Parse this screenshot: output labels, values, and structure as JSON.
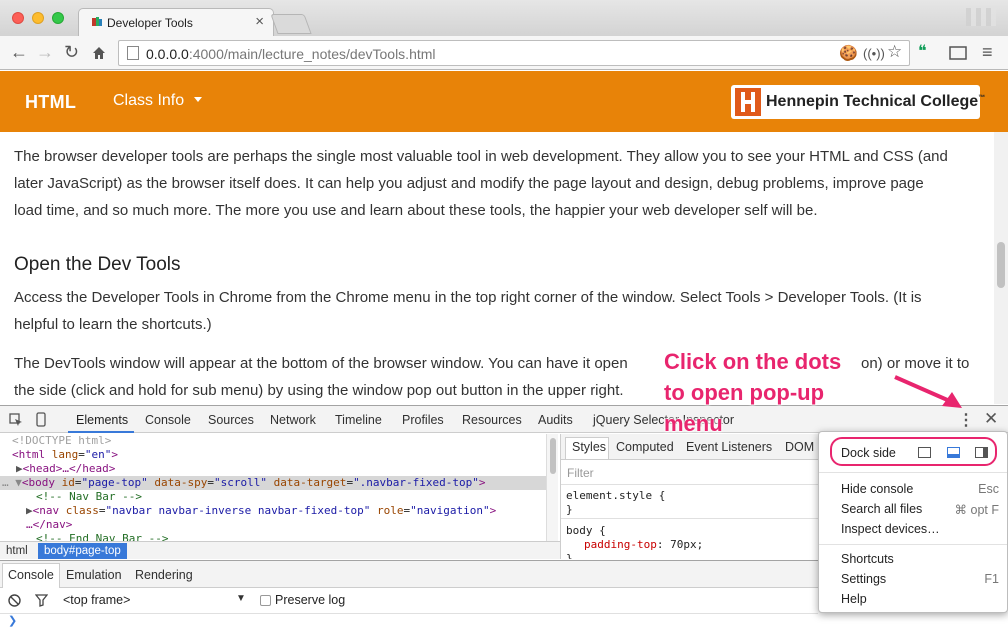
{
  "browser": {
    "tab_title": "Developer Tools",
    "tab_close": "×",
    "url_host": "0.0.0.0",
    "url_rest": ":4000/main/lecture_notes/devTools.html"
  },
  "site": {
    "brand": "HTML",
    "nav_item": "Class Info",
    "college_name": "Hennepin Technical College",
    "college_mark": "™"
  },
  "content": {
    "intro_lines": [
      "The browser developer tools are perhaps the single most valuable tool in web development. They allow you to see your HTML and CSS (and",
      "later JavaScript) as the browser itself does. It can help you adjust and modify the page layout and design, debug problems, improve page",
      "load time, and so much more. The more you use and learn about these tools, the happier your web developer self will be."
    ],
    "heading": "Open the Dev Tools",
    "open_lines": [
      "Access the Developer Tools in Chrome from the Chrome menu in the top right corner of the window. Select Tools > Developer Tools. (It is",
      "helpful to learn the shortcuts.)"
    ],
    "devtools_lines": [
      "The DevTools window will appear at the bottom of the browser window. You can have it open",
      "on) or move it to",
      "the side (click and hold for sub menu) by using the window pop out button in the upper right."
    ]
  },
  "devtools": {
    "tabs": [
      "Elements",
      "Console",
      "Sources",
      "Network",
      "Timeline",
      "Profiles",
      "Resources",
      "Audits",
      "jQuery Selector Inspector"
    ],
    "active_tab": "Elements",
    "code": {
      "doctype": "<!DOCTYPE html>",
      "html_open": "<html",
      "html_lang_attr": "lang",
      "html_lang_val": "\"en\"",
      "head": "<head>…</head>",
      "body_open": "<body",
      "body_id_attr": "id",
      "body_id_val": "\"page-top\"",
      "body_spy_attr": "data-spy",
      "body_spy_val": "\"scroll\"",
      "body_target_attr": "data-target",
      "body_target_val": "\".navbar-fixed-top\"",
      "comment_navbar": "<!-- Nav Bar -->",
      "nav_open": "<nav",
      "nav_class_attr": "class",
      "nav_class_val": "\"navbar navbar-inverse navbar-fixed-top\"",
      "nav_role_attr": "role",
      "nav_role_val": "\"navigation\"",
      "nav_close": "…</nav>",
      "comment_end": "<!-- End Nav Bar -->"
    },
    "breadcrumb": [
      "html",
      "body#page-top"
    ],
    "styles_tabs": [
      "Styles",
      "Computed",
      "Event Listeners",
      "DOM"
    ],
    "filter_placeholder": "Filter",
    "element_style": "element.style {",
    "close_brace": "}",
    "body_rule": "body {",
    "body_prop": "padding-top",
    "body_val": ": 70px;",
    "drawer_tabs": [
      "Console",
      "Emulation",
      "Rendering"
    ],
    "frame": "<top frame>",
    "preserve_log": "Preserve log",
    "prompt": "❯"
  },
  "menu": {
    "dock_side": "Dock side",
    "items_group1": [
      {
        "label": "Hide console",
        "shortcut": "Esc"
      },
      {
        "label": "Search all files",
        "shortcut": "⌘ opt F"
      },
      {
        "label": "Inspect devices…",
        "shortcut": ""
      }
    ],
    "items_group2": [
      {
        "label": "Shortcuts",
        "shortcut": ""
      },
      {
        "label": "Settings",
        "shortcut": "F1"
      },
      {
        "label": "Help",
        "shortcut": ""
      }
    ]
  },
  "annotation": {
    "line1": "Click on the dots",
    "line2": "to open pop-up",
    "line3": "menu"
  },
  "colors": {
    "navbar": "#e88308",
    "annotation": "#e8256e",
    "selection": "#3879d9"
  }
}
